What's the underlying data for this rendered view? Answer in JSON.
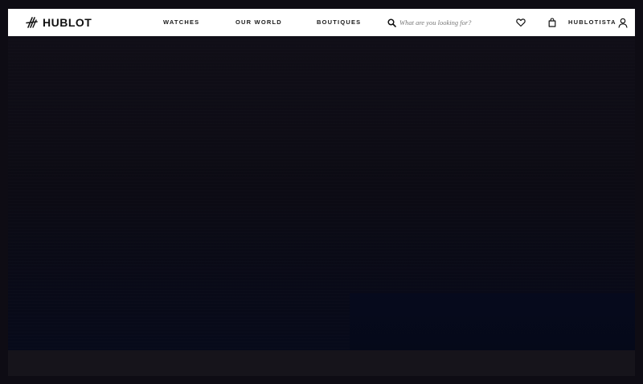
{
  "brand": {
    "name": "HUBLOT"
  },
  "nav": {
    "items": [
      {
        "label": "WATCHES"
      },
      {
        "label": "OUR WORLD"
      },
      {
        "label": "BOUTIQUES"
      }
    ]
  },
  "search": {
    "placeholder": "What are you looking for?"
  },
  "account": {
    "label": "HUBLOTISTA"
  },
  "icons": {
    "search": "search-icon",
    "wishlist": "heart-icon",
    "cart": "shopping-bag-icon",
    "user": "user-icon"
  },
  "colors": {
    "header_bg": "#ffffff",
    "text": "#1a1a1a",
    "page_bg": "#0e0c14",
    "hero_bottom": "#070a1a"
  }
}
